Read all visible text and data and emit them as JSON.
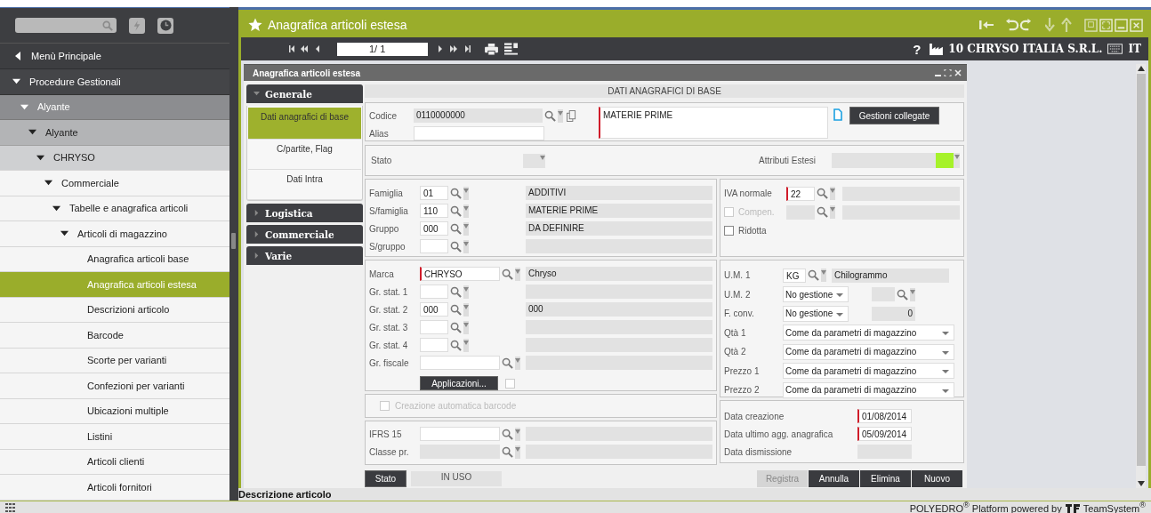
{
  "sidebar": {
    "back": "Menù Principale",
    "tree": [
      {
        "label": "Procedure Gestionali",
        "expanded": true,
        "selected": false,
        "children": [
          {
            "label": "Alyante",
            "expanded": true,
            "selected": false,
            "children": [
              {
                "label": "Alyante",
                "expanded": true,
                "selected": false,
                "children": [
                  {
                    "label": "CHRYSO",
                    "expanded": true,
                    "selected": false,
                    "children": [
                      {
                        "label": "Commerciale",
                        "expanded": true,
                        "selected": false,
                        "children": [
                          {
                            "label": "Tabelle e anagrafica articoli",
                            "expanded": true,
                            "selected": false,
                            "children": [
                              {
                                "label": "Articoli di magazzino",
                                "expanded": true,
                                "selected": false,
                                "children": [
                                  {
                                    "label": "Anagrafica articoli base",
                                    "selected": false
                                  },
                                  {
                                    "label": "Anagrafica articoli estesa",
                                    "selected": true
                                  },
                                  {
                                    "label": "Descrizioni articolo",
                                    "selected": false
                                  },
                                  {
                                    "label": "Barcode",
                                    "selected": false
                                  },
                                  {
                                    "label": "Scorte per varianti",
                                    "selected": false
                                  },
                                  {
                                    "label": "Confezioni per varianti",
                                    "selected": false
                                  },
                                  {
                                    "label": "Ubicazioni multiple",
                                    "selected": false
                                  },
                                  {
                                    "label": "Listini",
                                    "selected": false
                                  },
                                  {
                                    "label": "Articoli clienti",
                                    "selected": false
                                  },
                                  {
                                    "label": "Articoli fornitori",
                                    "selected": false
                                  }
                                ]
                              }
                            ]
                          }
                        ]
                      }
                    ]
                  }
                ]
              }
            ]
          }
        ]
      }
    ]
  },
  "window": {
    "title": "Anagrafica articoli estesa"
  },
  "toolbar": {
    "page": "1/ 1",
    "help": "?",
    "company": "10 CHRYSO ITALIA S.R.L.",
    "language": "IT"
  },
  "panel": {
    "title": "Anagrafica articoli estesa"
  },
  "accordion": [
    {
      "label": "Generale",
      "expanded": true,
      "items": [
        {
          "label": "Dati anagrafici di base",
          "selected": true
        },
        {
          "label": "C/partite, Flag",
          "selected": false
        },
        {
          "label": "Dati Intra",
          "selected": false
        }
      ]
    },
    {
      "label": "Logistica",
      "expanded": false
    },
    {
      "label": "Commerciale",
      "expanded": false
    },
    {
      "label": "Varie",
      "expanded": false
    }
  ],
  "section_title": "DATI ANAGRAFICI DI BASE",
  "header": {
    "code_label": "Codice",
    "code": "0110000000",
    "alias_label": "Alias",
    "description": "MATERIE PRIME",
    "linked_button": "Gestioni collegate"
  },
  "state_row": {
    "state_label": "Stato",
    "attributes_label": "Attributi Estesi"
  },
  "classification": [
    {
      "label": "Famiglia",
      "code": "01",
      "description": "ADDITIVI"
    },
    {
      "label": "S/famiglia",
      "code": "110",
      "description": "MATERIE PRIME"
    },
    {
      "label": "Gruppo",
      "code": "000",
      "description": "DA DEFINIRE"
    },
    {
      "label": "S/gruppo"
    }
  ],
  "vat": {
    "label": "IVA normale",
    "code": "22"
  },
  "vat_checks": [
    {
      "label": "Compen.",
      "checked": false,
      "disabled": true
    },
    {
      "label": "Ridotta",
      "checked": false,
      "disabled": false
    }
  ],
  "brand_rows": [
    {
      "kind": "wide",
      "label": "Marca",
      "code": "CHRYSO",
      "description": "Chryso",
      "required": true
    },
    {
      "kind": "short",
      "label": "Gr. stat. 1",
      "required": false
    },
    {
      "kind": "short",
      "label": "Gr. stat. 2",
      "code": "000",
      "description": "000",
      "required": false
    },
    {
      "kind": "short",
      "label": "Gr. stat. 3",
      "required": false
    },
    {
      "kind": "short",
      "label": "Gr. stat. 4",
      "required": false
    },
    {
      "kind": "wide",
      "label": "Gr. fiscale",
      "required": false
    }
  ],
  "applications": {
    "label": "Applicazioni...",
    "checked": false
  },
  "units": [
    {
      "kind": "lookup",
      "label": "U.M. 1",
      "code": "KG",
      "description": "Chilogrammo"
    },
    {
      "kind": "select_lookup",
      "label": "U.M. 2",
      "value": "No gestione"
    },
    {
      "kind": "select_number",
      "label": "F. conv.",
      "value": "No gestione",
      "number": "0"
    },
    {
      "kind": "select",
      "label": "Qtà 1",
      "value": "Come da parametri di magazzino"
    },
    {
      "kind": "select",
      "label": "Qtà 2",
      "value": "Come da parametri di magazzino"
    },
    {
      "kind": "select",
      "label": "Prezzo 1",
      "value": "Come da parametri di magazzino"
    },
    {
      "kind": "select",
      "label": "Prezzo 2",
      "value": "Come da parametri di magazzino"
    }
  ],
  "barcode": {
    "label": "Creazione automatica barcode",
    "checked": false,
    "disabled": true
  },
  "ifrs": [
    {
      "label": "IFRS 15",
      "editable": true
    },
    {
      "label": "Classe pr.",
      "editable": false
    }
  ],
  "dates": [
    {
      "label": "Data creazione",
      "value": "01/08/2014",
      "editable": true
    },
    {
      "label": "Data ultimo agg. anagrafica",
      "value": "05/09/2014",
      "editable": true
    },
    {
      "label": "Data dismissione",
      "editable": false
    }
  ],
  "status": {
    "button": "Stato",
    "value": "IN USO"
  },
  "actions": [
    {
      "label": "Registra",
      "disabled": true
    },
    {
      "label": "Annulla",
      "disabled": false
    },
    {
      "label": "Elimina",
      "disabled": false
    },
    {
      "label": "Nuovo",
      "disabled": false
    }
  ],
  "status_line": "Descrizione articolo",
  "footer": {
    "platform": "POLYEDRO$^{®}$ Platform powered by",
    "brand": "TeamSystem$^{®}$"
  }
}
